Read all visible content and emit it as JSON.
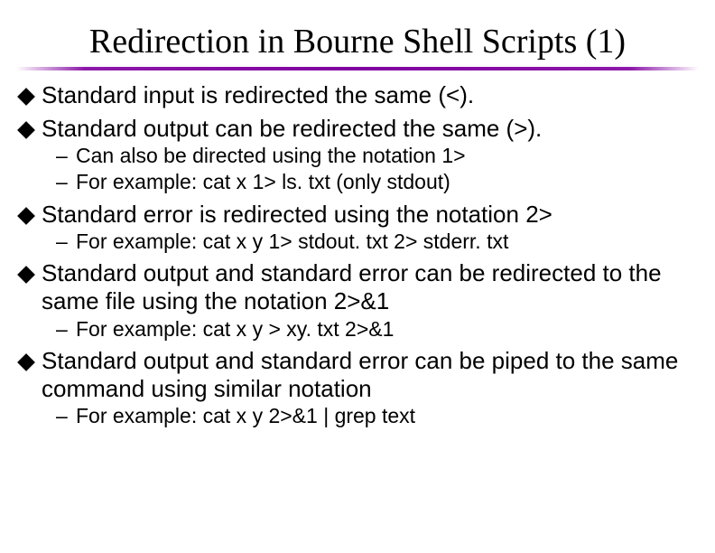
{
  "title": "Redirection in Bourne Shell Scripts (1)",
  "bullets": {
    "b1": "Standard input is redirected the same (<).",
    "b2": "Standard output can be redirected the same (>).",
    "b3": "Standard error is redirected using the notation 2>",
    "b4": "Standard output and standard error can be redirected to the same file using the notation 2>&1",
    "b5": "Standard output and standard error can be piped to the same command using similar notation"
  },
  "subs": {
    "s1": "Can also be directed using the notation 1>",
    "s2": "For example:  cat x 1> ls. txt    (only stdout)",
    "s3": "For example:  cat x y 1> stdout. txt 2> stderr. txt",
    "s4": "For example:  cat x y > xy. txt 2>&1",
    "s5": "For example:  cat x y 2>&1 | grep text"
  },
  "dash": "–"
}
